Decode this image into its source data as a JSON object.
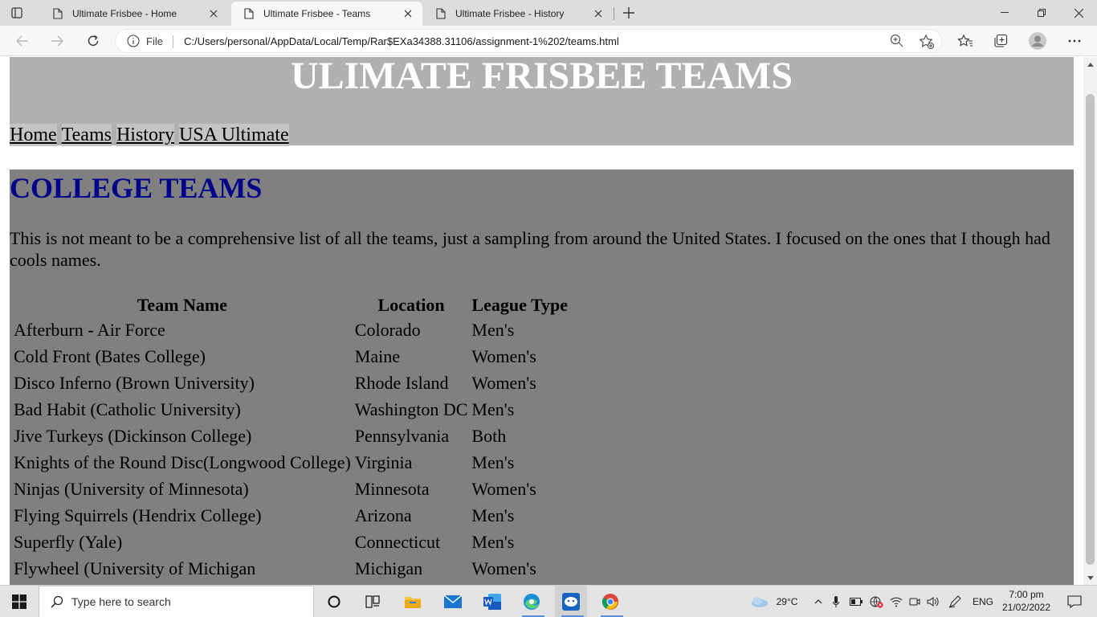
{
  "browser": {
    "tabs": [
      {
        "title": "Ultimate Frisbee - Home",
        "active": false
      },
      {
        "title": "Ultimate Frisbee - Teams",
        "active": true
      },
      {
        "title": "Ultimate Frisbee - History",
        "active": false
      }
    ],
    "address": {
      "scheme_label": "File",
      "url": "C:/Users/personal/AppData/Local/Temp/Rar$EXa34388.31106/assignment-1%202/teams.html"
    }
  },
  "page": {
    "site_title": "ULIMATE FRISBEE TEAMS",
    "nav": [
      "Home",
      "Teams",
      "History",
      "USA Ultimate"
    ],
    "section_title": "COLLEGE TEAMS",
    "intro": "This is not meant to be a comprehensive list of all the teams, just a sampling from around the United States. I focused on the ones that I though had cools names.",
    "table": {
      "headers": [
        "Team Name",
        "Location",
        "League Type"
      ],
      "rows": [
        [
          "Afterburn - Air Force",
          "Colorado",
          "Men's"
        ],
        [
          "Cold Front (Bates College)",
          "Maine",
          "Women's"
        ],
        [
          "Disco Inferno (Brown University)",
          "Rhode Island",
          "Women's"
        ],
        [
          "Bad Habit (Catholic University)",
          "Washington DC",
          "Men's"
        ],
        [
          "Jive Turkeys (Dickinson College)",
          "Pennsylvania",
          "Both"
        ],
        [
          "Knights of the Round Disc(Longwood College)",
          "Virginia",
          "Men's"
        ],
        [
          "Ninjas (University of Minnesota)",
          "Minnesota",
          "Women's"
        ],
        [
          "Flying Squirrels (Hendrix College)",
          "Arizona",
          "Men's"
        ],
        [
          "Superfly (Yale)",
          "Connecticut",
          "Men's"
        ],
        [
          "Flywheel (University of Michigan",
          "Michigan",
          "Women's"
        ]
      ]
    }
  },
  "colors": {
    "header_bg": "#b0b0b0",
    "content_bg": "#808080",
    "section_title": "#00008b"
  },
  "taskbar": {
    "search_placeholder": "Type here to search",
    "weather": "29°C",
    "language": "ENG",
    "time": "7:00 pm",
    "date": "21/02/2022"
  }
}
